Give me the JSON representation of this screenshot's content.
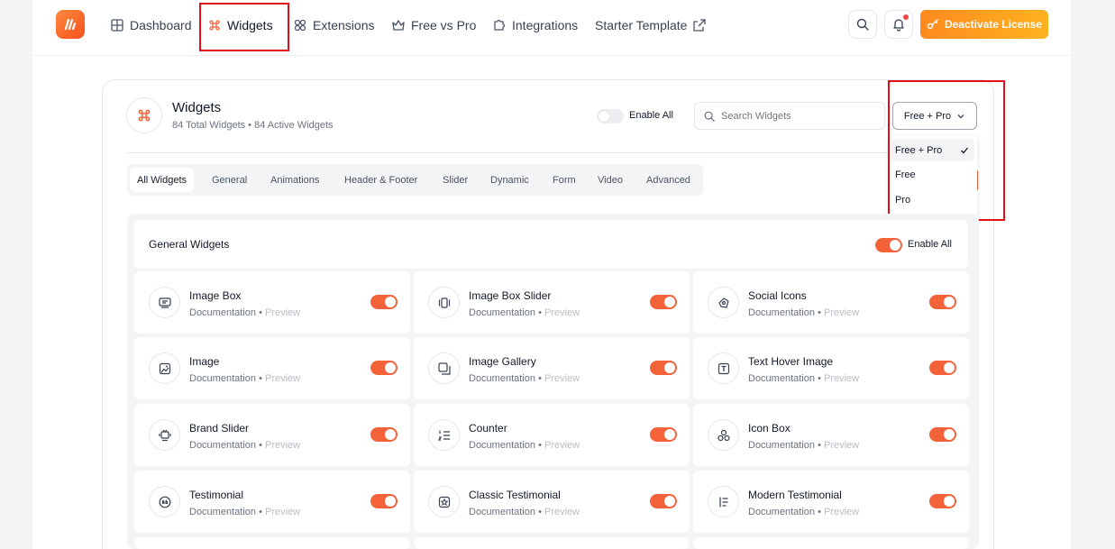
{
  "nav": {
    "items": [
      {
        "label": "Dashboard",
        "icon": "dashboard-icon"
      },
      {
        "label": "Widgets",
        "icon": "command-icon",
        "active": true
      },
      {
        "label": "Extensions",
        "icon": "extensions-icon"
      },
      {
        "label": "Free vs Pro",
        "icon": "crown-icon"
      },
      {
        "label": "Integrations",
        "icon": "puzzle-icon"
      },
      {
        "label": "Starter Template",
        "icon": "external-link-icon"
      }
    ],
    "deactivate_label": "Deactivate License"
  },
  "header": {
    "title": "Widgets",
    "subtitle": "84 Total Widgets • 84 Active Widgets",
    "enable_all_label": "Enable All",
    "enable_all_on": false,
    "search_placeholder": "Search Widgets",
    "filter_value": "Free + Pro"
  },
  "filter_options": [
    {
      "label": "Free + Pro",
      "selected": true
    },
    {
      "label": "Free",
      "selected": false
    },
    {
      "label": "Pro",
      "selected": false
    }
  ],
  "tabs": [
    "All Widgets",
    "General",
    "Animations",
    "Header & Footer",
    "Slider",
    "Dynamic",
    "Form",
    "Video",
    "Advanced"
  ],
  "section": {
    "title": "General Widgets",
    "enable_all_label": "Enable All",
    "enable_all_on": true
  },
  "widget_links": {
    "doc": "Documentation",
    "separator": "•",
    "preview": "Preview"
  },
  "widgets": [
    {
      "name": "Image Box",
      "icon": "image-box-icon",
      "on": true
    },
    {
      "name": "Image Box Slider",
      "icon": "slider-icon",
      "on": true
    },
    {
      "name": "Social Icons",
      "icon": "social-icon",
      "on": true
    },
    {
      "name": "Image",
      "icon": "image-icon",
      "on": true
    },
    {
      "name": "Image Gallery",
      "icon": "gallery-icon",
      "on": true
    },
    {
      "name": "Text Hover Image",
      "icon": "text-hover-icon",
      "on": true
    },
    {
      "name": "Brand Slider",
      "icon": "brand-slider-icon",
      "on": true
    },
    {
      "name": "Counter",
      "icon": "counter-icon",
      "on": true
    },
    {
      "name": "Icon Box",
      "icon": "icon-box-icon",
      "on": true
    },
    {
      "name": "Testimonial",
      "icon": "quote-icon",
      "on": true
    },
    {
      "name": "Classic Testimonial",
      "icon": "star-badge-icon",
      "on": true
    },
    {
      "name": "Modern Testimonial",
      "icon": "list-icon",
      "on": true
    }
  ],
  "colors": {
    "accent": "#f4623a",
    "highlight": "#e0101b",
    "deactivate": "#ff9a1f"
  }
}
